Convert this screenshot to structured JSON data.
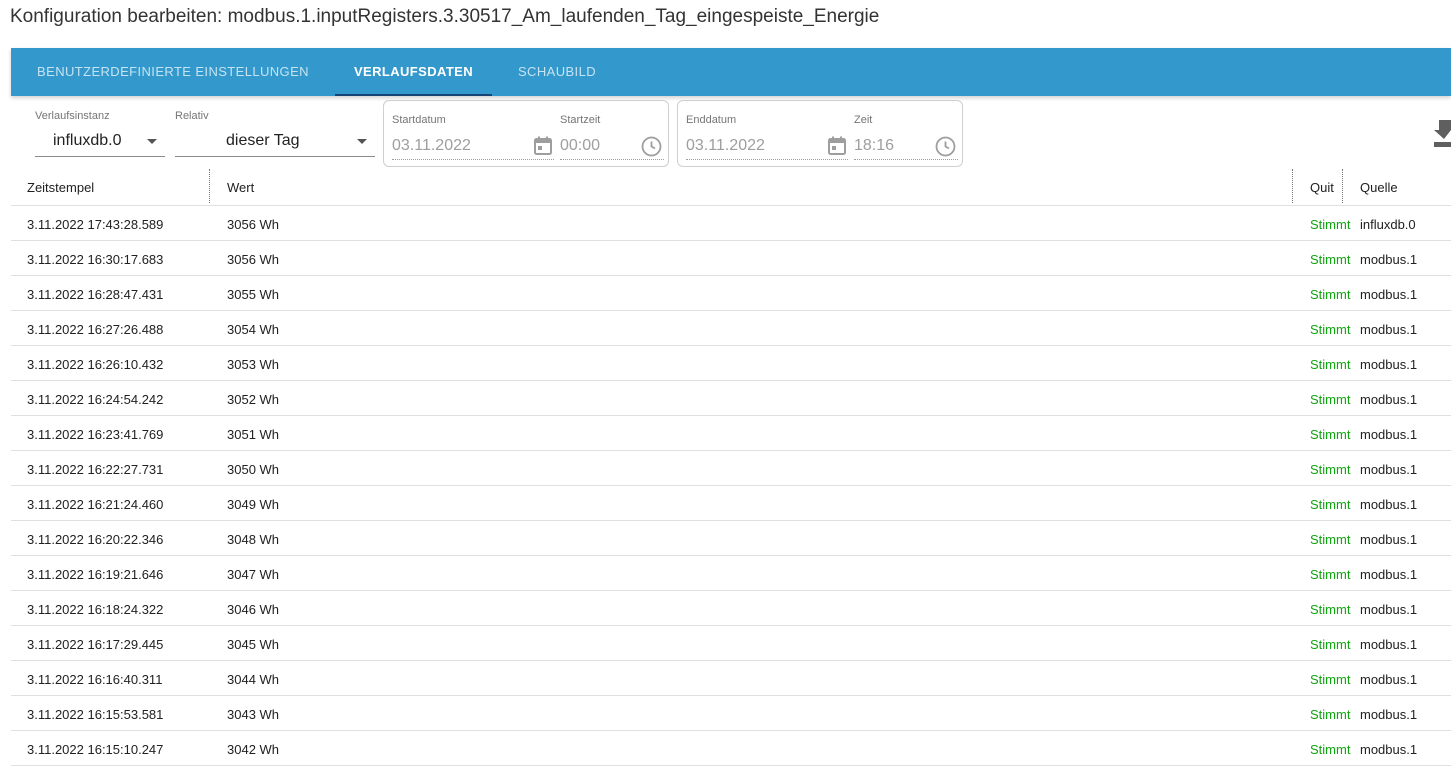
{
  "page": {
    "title": "Konfiguration bearbeiten: modbus.1.inputRegisters.3.30517_Am_laufenden_Tag_eingespeiste_Energie"
  },
  "tabs": [
    {
      "label": "BENUTZERDEFINIERTE EINSTELLUNGEN",
      "active": false
    },
    {
      "label": "VERLAUFSDATEN",
      "active": true
    },
    {
      "label": "SCHAUBILD",
      "active": false
    }
  ],
  "filters": {
    "instance": {
      "label": "Verlaufsinstanz",
      "value": "influxdb.0"
    },
    "relative": {
      "label": "Relativ",
      "value": "dieser Tag"
    },
    "start_date": {
      "label": "Startdatum",
      "value": "03.11.2022"
    },
    "start_time": {
      "label": "Startzeit",
      "value": "00:00"
    },
    "end_date": {
      "label": "Enddatum",
      "value": "03.11.2022"
    },
    "end_time": {
      "label": "Zeit",
      "value": "18:16"
    }
  },
  "table": {
    "columns": {
      "timestamp": "Zeitstempel",
      "value": "Wert",
      "quality": "Quit",
      "source": "Quelle"
    },
    "rows": [
      {
        "timestamp": "3.11.2022 17:43:28.589",
        "value": "3056 Wh",
        "quality": "Stimmt",
        "source": "influxdb.0"
      },
      {
        "timestamp": "3.11.2022 16:30:17.683",
        "value": "3056 Wh",
        "quality": "Stimmt",
        "source": "modbus.1"
      },
      {
        "timestamp": "3.11.2022 16:28:47.431",
        "value": "3055 Wh",
        "quality": "Stimmt",
        "source": "modbus.1"
      },
      {
        "timestamp": "3.11.2022 16:27:26.488",
        "value": "3054 Wh",
        "quality": "Stimmt",
        "source": "modbus.1"
      },
      {
        "timestamp": "3.11.2022 16:26:10.432",
        "value": "3053 Wh",
        "quality": "Stimmt",
        "source": "modbus.1"
      },
      {
        "timestamp": "3.11.2022 16:24:54.242",
        "value": "3052 Wh",
        "quality": "Stimmt",
        "source": "modbus.1"
      },
      {
        "timestamp": "3.11.2022 16:23:41.769",
        "value": "3051 Wh",
        "quality": "Stimmt",
        "source": "modbus.1"
      },
      {
        "timestamp": "3.11.2022 16:22:27.731",
        "value": "3050 Wh",
        "quality": "Stimmt",
        "source": "modbus.1"
      },
      {
        "timestamp": "3.11.2022 16:21:24.460",
        "value": "3049 Wh",
        "quality": "Stimmt",
        "source": "modbus.1"
      },
      {
        "timestamp": "3.11.2022 16:20:22.346",
        "value": "3048 Wh",
        "quality": "Stimmt",
        "source": "modbus.1"
      },
      {
        "timestamp": "3.11.2022 16:19:21.646",
        "value": "3047 Wh",
        "quality": "Stimmt",
        "source": "modbus.1"
      },
      {
        "timestamp": "3.11.2022 16:18:24.322",
        "value": "3046 Wh",
        "quality": "Stimmt",
        "source": "modbus.1"
      },
      {
        "timestamp": "3.11.2022 16:17:29.445",
        "value": "3045 Wh",
        "quality": "Stimmt",
        "source": "modbus.1"
      },
      {
        "timestamp": "3.11.2022 16:16:40.311",
        "value": "3044 Wh",
        "quality": "Stimmt",
        "source": "modbus.1"
      },
      {
        "timestamp": "3.11.2022 16:15:53.581",
        "value": "3043 Wh",
        "quality": "Stimmt",
        "source": "modbus.1"
      },
      {
        "timestamp": "3.11.2022 16:15:10.247",
        "value": "3042 Wh",
        "quality": "Stimmt",
        "source": "modbus.1"
      }
    ]
  },
  "icons": {
    "calendar": "calendar-icon",
    "clock": "clock-icon",
    "download": "download-icon",
    "dropdown": "chevron-down-icon"
  },
  "colors": {
    "tabbar": "#3399cc",
    "tab_indicator": "#164477",
    "quality_ok": "#0fa50f"
  }
}
